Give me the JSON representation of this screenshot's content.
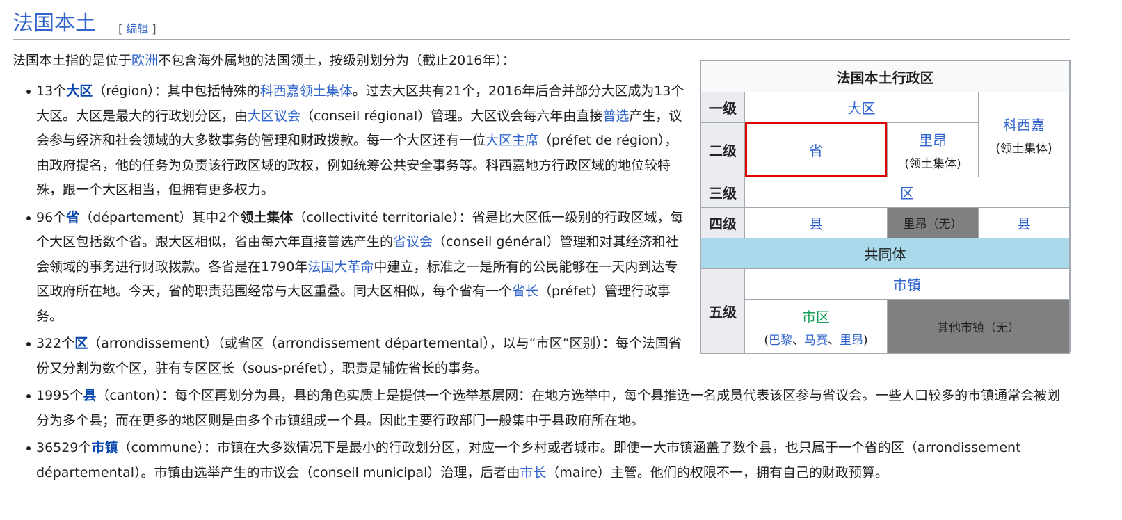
{
  "heading": {
    "title": "法国本土",
    "edit_open": "[ ",
    "edit_label": "编辑",
    "edit_close": " ]"
  },
  "intro": {
    "pre": "法国本土指的是位于",
    "link": "欧洲",
    "post": "不包含海外属地的法国领土，按级别划分为（截止2016年）："
  },
  "items": [
    {
      "count": "13个",
      "term": "大区",
      "p1": "（région）：其中包括特殊的",
      "l1": "科西嘉领土集体",
      "p2": "。过去大区共有21个，2016年后合并部分大区成为13个大区。大区是最大的行政划分区，由",
      "l2": "大区议会",
      "p3": "（conseil régional）管理。大区议会每六年由直接",
      "l3": "普选",
      "p4": "产生，议会参与经济和社会领域的大多数事务的管理和财政拨款。每一个大区还有一位",
      "l4": "大区主席",
      "p5": "（préfet de région），由政府提名，他的任务为负责该行政区域的政权，例如统筹公共安全事务等。科西嘉地方行政区域的地位较特殊，跟一个大区相当，但拥有更多权力。"
    },
    {
      "count": "96个",
      "term": "省",
      "p1": "（département）其中2个",
      "b1": "领土集体",
      "p2": "（collectivité territoriale）：省是比大区低一级别的行政区域，每个大区包括数个省。跟大区相似，省由每六年直接普选产生的",
      "l1": "省议会",
      "p3": "（conseil général）管理和对其经济和社会领域的事务进行财政拨款。各省是在1790年",
      "l2": "法国大革命",
      "p4": "中建立，标准之一是所有的公民能够在一天内到达专区政府所在地。今天，省的职责范围经常与大区重叠。同大区相似，每个省有一个",
      "l3": "省长",
      "p5": "（préfet）管理行政事务。"
    },
    {
      "count": "322个",
      "term": "区",
      "p1": "（arrondissement）（或省区（arrondissement départemental），以与“市区”区别）：每个法国省份又分割为数个区，驻有专区区长（sous-préfet），职责是辅佐省长的事务。"
    },
    {
      "count": "1995个",
      "term": "县",
      "p1": "（canton）：每个区再划分为县，县的角色实质上是提供一个选举基层网：在地方选举中，每个县推选一名成员代表该区参与省议会。一些人口较多的市镇通常会被划分为多个县；而在更多的地区则是由多个市镇组成一个县。因此主要行政部门一般集中于县政府所在地。"
    },
    {
      "count": "36529个",
      "term": "市镇",
      "p1": "（commune）：市镇在大多数情况下是最小的行政划分区，对应一个乡村或者城市。即使一大市镇涵盖了数个县，也只属于一个省的区（arrondissement départemental）。市镇由选举产生的市议会（conseil municipal）治理，后者由",
      "l1": "市长",
      "p2": "（maire）主管。他们的权限不一，拥有自己的财政预算。"
    }
  ],
  "table": {
    "caption": "法国本土行政区",
    "levels": [
      "一级",
      "二级",
      "三级",
      "四级",
      "五级"
    ],
    "daqu": "大区",
    "corsica": "科西嘉",
    "corsica_sub": "(领土集体)",
    "sheng": "省",
    "lyon": "里昂",
    "lyon_sub": "(领土集体)",
    "qu": "区",
    "xian1": "县",
    "lyon_none": "里昂（无）",
    "xian2": "县",
    "commonality": "共同体",
    "shizhen": "市镇",
    "shiqu": "市区",
    "shiqu_open": "(",
    "paris": "巴黎",
    "sep1": "、",
    "marseille": "马赛",
    "sep2": "、",
    "lyon2": "里昂",
    "shiqu_close": ")",
    "other_towns": "其他市镇（无）"
  },
  "colors": {
    "link": "#3366cc",
    "highlight": "#e00000",
    "commune_row": "#a9d9ea",
    "none_cell": "#808080"
  }
}
